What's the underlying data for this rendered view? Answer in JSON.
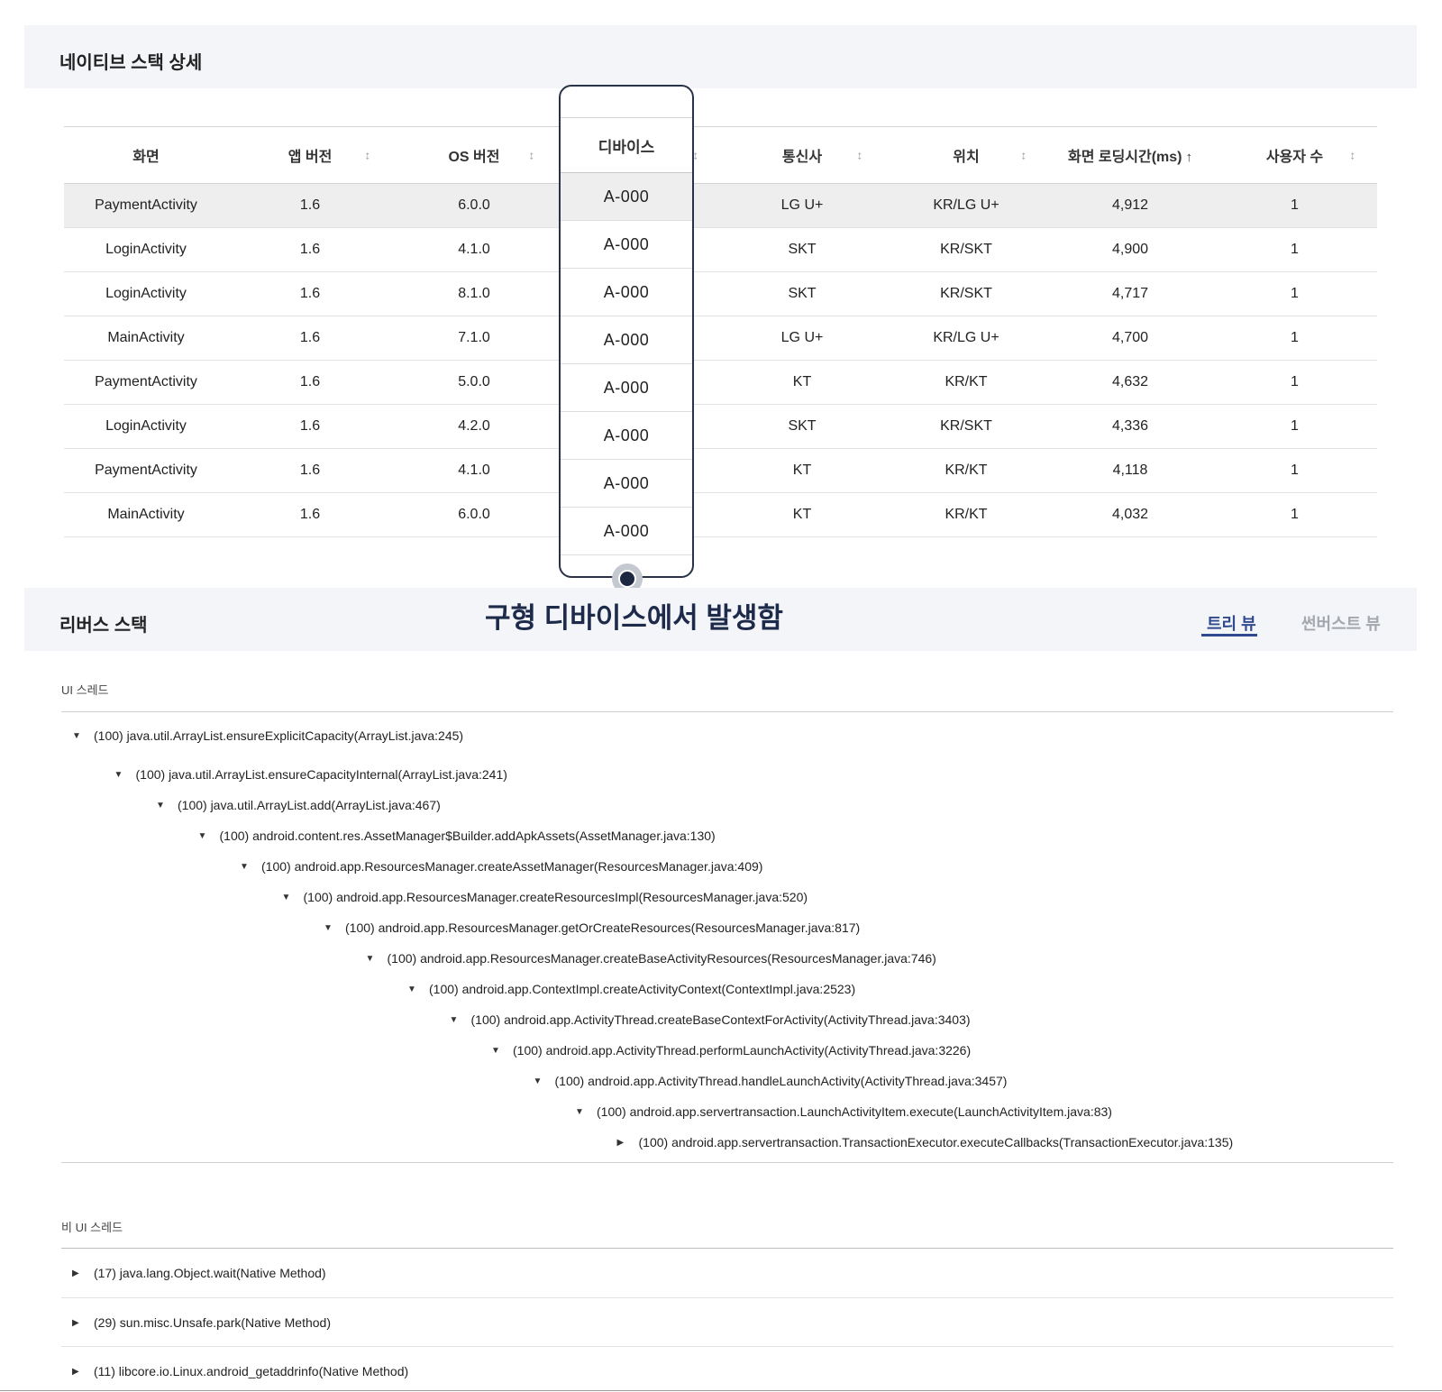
{
  "native_stack": {
    "title": "네이티브 스택 상세",
    "columns": [
      "화면",
      "앱 버전",
      "OS 버전",
      "디바이스",
      "통신사",
      "위치",
      "화면 로딩시간(ms)",
      "사용자 수"
    ],
    "rows": [
      {
        "screen": "PaymentActivity",
        "app": "1.6",
        "os": "6.0.0",
        "device": "A-000",
        "carrier": "LG U+",
        "location": "KR/LG U+",
        "loading": "4,912",
        "users": "1"
      },
      {
        "screen": "LoginActivity",
        "app": "1.6",
        "os": "4.1.0",
        "device": "A-000",
        "carrier": "SKT",
        "location": "KR/SKT",
        "loading": "4,900",
        "users": "1"
      },
      {
        "screen": "LoginActivity",
        "app": "1.6",
        "os": "8.1.0",
        "device": "A-000",
        "carrier": "SKT",
        "location": "KR/SKT",
        "loading": "4,717",
        "users": "1"
      },
      {
        "screen": "MainActivity",
        "app": "1.6",
        "os": "7.1.0",
        "device": "A-000",
        "carrier": "LG U+",
        "location": "KR/LG U+",
        "loading": "4,700",
        "users": "1"
      },
      {
        "screen": "PaymentActivity",
        "app": "1.6",
        "os": "5.0.0",
        "device": "A-000",
        "carrier": "KT",
        "location": "KR/KT",
        "loading": "4,632",
        "users": "1"
      },
      {
        "screen": "LoginActivity",
        "app": "1.6",
        "os": "4.2.0",
        "device": "A-000",
        "carrier": "SKT",
        "location": "KR/SKT",
        "loading": "4,336",
        "users": "1"
      },
      {
        "screen": "PaymentActivity",
        "app": "1.6",
        "os": "4.1.0",
        "device": "A-000",
        "carrier": "KT",
        "location": "KR/KT",
        "loading": "4,118",
        "users": "1"
      },
      {
        "screen": "MainActivity",
        "app": "1.6",
        "os": "6.0.0",
        "device": "A-000",
        "carrier": "KT",
        "location": "KR/KT",
        "loading": "4,032",
        "users": "1"
      }
    ],
    "sort_icon": "↕",
    "sort_active_icon": "↑"
  },
  "callout": "구형 디바이스에서 발생함",
  "reverse_stack": {
    "title": "리버스 스택",
    "tabs": [
      "트리 뷰",
      "썬버스트 뷰"
    ],
    "ui_thread_label": "UI 스레드",
    "ui_tree": [
      {
        "text": "(100) java.util.ArrayList.ensureExplicitCapacity(ArrayList.java:245)",
        "expanded": true
      },
      {
        "text": "(100) java.util.ArrayList.ensureCapacityInternal(ArrayList.java:241)",
        "expanded": true
      },
      {
        "text": "(100) java.util.ArrayList.add(ArrayList.java:467)",
        "expanded": true
      },
      {
        "text": "(100) android.content.res.AssetManager$Builder.addApkAssets(AssetManager.java:130)",
        "expanded": true
      },
      {
        "text": "(100) android.app.ResourcesManager.createAssetManager(ResourcesManager.java:409)",
        "expanded": true
      },
      {
        "text": "(100) android.app.ResourcesManager.createResourcesImpl(ResourcesManager.java:520)",
        "expanded": true
      },
      {
        "text": "(100) android.app.ResourcesManager.getOrCreateResources(ResourcesManager.java:817)",
        "expanded": true
      },
      {
        "text": "(100) android.app.ResourcesManager.createBaseActivityResources(ResourcesManager.java:746)",
        "expanded": true
      },
      {
        "text": "(100) android.app.ContextImpl.createActivityContext(ContextImpl.java:2523)",
        "expanded": true
      },
      {
        "text": "(100) android.app.ActivityThread.createBaseContextForActivity(ActivityThread.java:3403)",
        "expanded": true
      },
      {
        "text": "(100) android.app.ActivityThread.performLaunchActivity(ActivityThread.java:3226)",
        "expanded": true
      },
      {
        "text": "(100) android.app.ActivityThread.handleLaunchActivity(ActivityThread.java:3457)",
        "expanded": true
      },
      {
        "text": "(100) android.app.servertransaction.LaunchActivityItem.execute(LaunchActivityItem.java:83)",
        "expanded": true
      },
      {
        "text": "(100) android.app.servertransaction.TransactionExecutor.executeCallbacks(TransactionExecutor.java:135)",
        "expanded": false
      }
    ],
    "non_ui_thread_label": "비 UI 스레드",
    "non_ui_tree": [
      {
        "text": "(17) java.lang.Object.wait(Native Method)"
      },
      {
        "text": "(29) sun.misc.Unsafe.park(Native Method)"
      },
      {
        "text": "(11) libcore.io.Linux.android_getaddrinfo(Native Method)"
      }
    ],
    "expanded_icon": "▼",
    "collapsed_icon": "▶"
  }
}
